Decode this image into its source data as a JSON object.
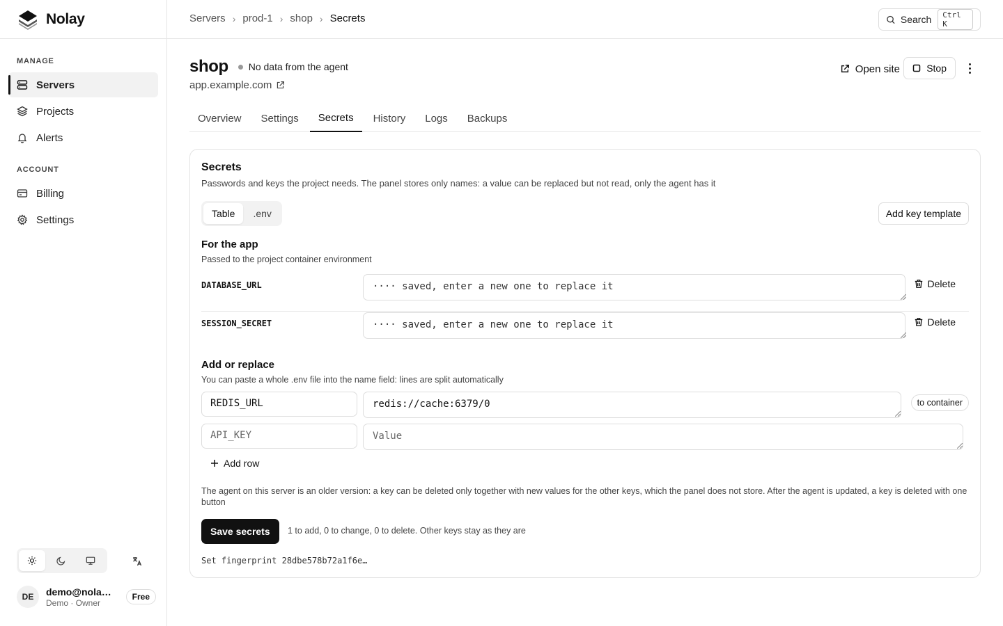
{
  "brand": {
    "name": "Nolay"
  },
  "sidebar": {
    "sections": [
      {
        "title": "MANAGE",
        "items": [
          {
            "label": "Servers",
            "icon": "server-icon",
            "active": true
          },
          {
            "label": "Projects",
            "icon": "layers-icon"
          },
          {
            "label": "Alerts",
            "icon": "bell-icon"
          }
        ]
      },
      {
        "title": "ACCOUNT",
        "items": [
          {
            "label": "Billing",
            "icon": "credit-card-icon"
          },
          {
            "label": "Settings",
            "icon": "gear-icon"
          }
        ]
      }
    ],
    "theme": {
      "options": [
        "sun-icon",
        "moon-icon",
        "monitor-icon"
      ],
      "active": "sun-icon"
    },
    "language_icon": "translate-icon",
    "user": {
      "initials": "DE",
      "email": "demo@nolay.app",
      "role": "Demo · Owner",
      "plan": "Free"
    }
  },
  "topbar": {
    "breadcrumb": [
      "Servers",
      "prod-1",
      "shop",
      "Secrets"
    ],
    "search": {
      "label": "Search",
      "shortcut": "Ctrl K"
    }
  },
  "header": {
    "title": "shop",
    "status": "No data from the agent",
    "site": "app.example.com",
    "open_site_label": "Open site",
    "stop_label": "Stop"
  },
  "tabs": [
    {
      "label": "Overview"
    },
    {
      "label": "Settings"
    },
    {
      "label": "Secrets",
      "active": true
    },
    {
      "label": "History"
    },
    {
      "label": "Logs"
    },
    {
      "label": "Backups"
    }
  ],
  "secrets_card": {
    "title": "Secrets",
    "description": "Passwords and keys the project needs. The panel stores only names: a value can be replaced but not read, only the agent has it",
    "view_options": [
      "Table",
      ".env"
    ],
    "active_view": "Table",
    "add_template_label": "Add key template",
    "app_section": {
      "title": "For the app",
      "description": "Passed to the project container environment",
      "rows": [
        {
          "key": "DATABASE_URL",
          "placeholder": "···· saved, enter a new one to replace it",
          "delete_label": "Delete"
        },
        {
          "key": "SESSION_SECRET",
          "placeholder": "···· saved, enter a new one to replace it",
          "delete_label": "Delete"
        }
      ]
    },
    "add_section": {
      "title": "Add or replace",
      "description": "You can paste a whole .env file into the name field: lines are split automatically",
      "rows": [
        {
          "name": "REDIS_URL",
          "value": "redis://cache:6379/0",
          "scope": "to container"
        },
        {
          "name_placeholder": "API_KEY",
          "value_placeholder": "Value"
        }
      ],
      "add_row_label": "Add row"
    },
    "agent_warning": "The agent on this server is an older version: a key can be deleted only together with new values for the other keys, which the panel does not store. After the agent is updated, a key is deleted with one button",
    "save_label": "Save secrets",
    "save_summary": "1 to add, 0 to change, 0 to delete. Other keys stay as they are",
    "fingerprint": "Set fingerprint 28dbe578b72a1f6e…"
  }
}
